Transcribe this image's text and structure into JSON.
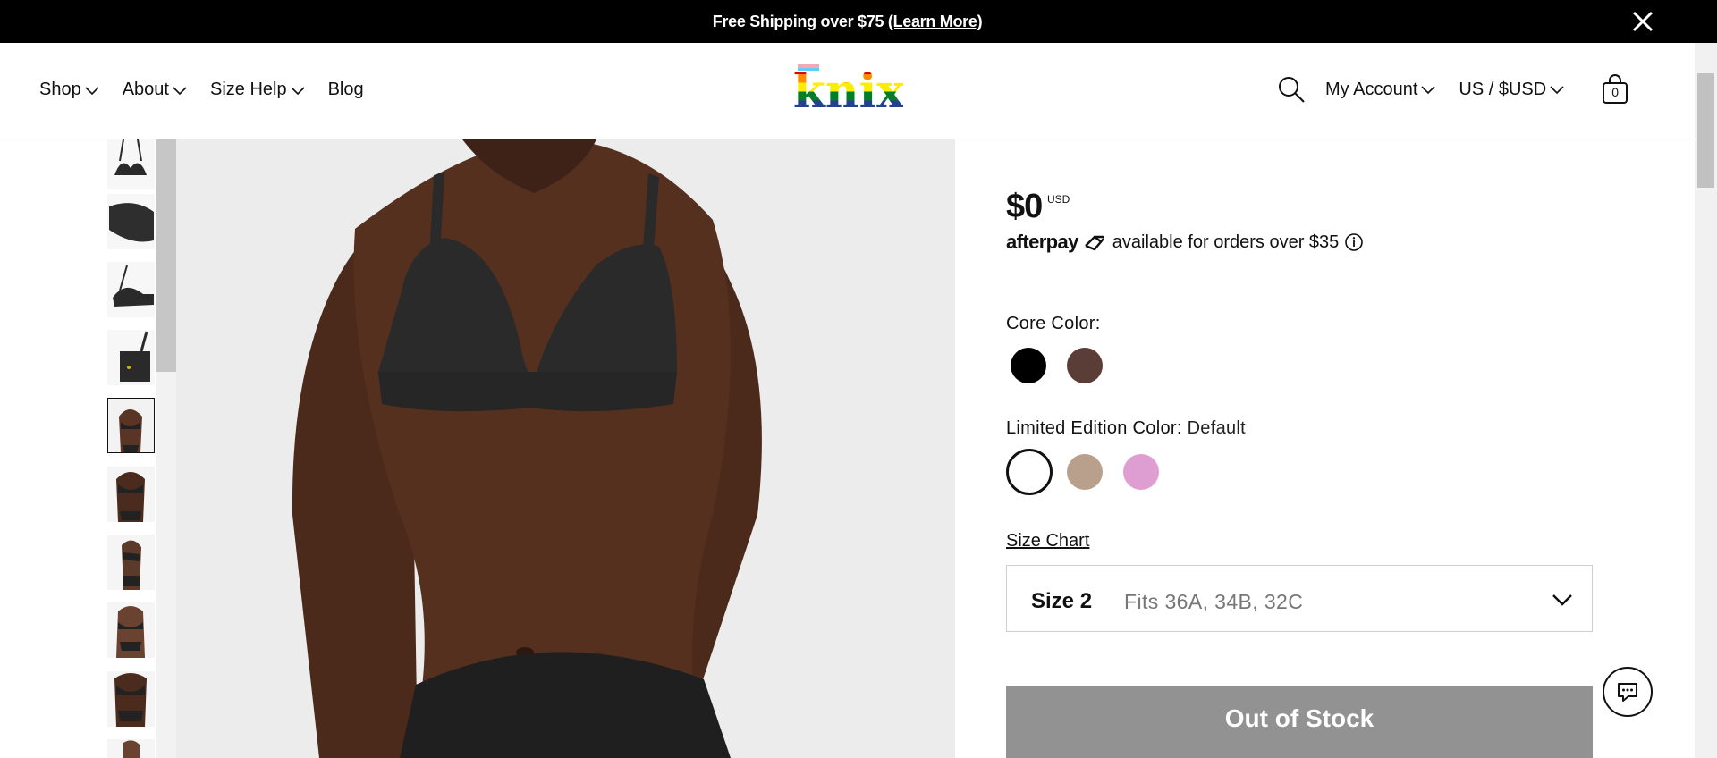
{
  "announcement": {
    "text": "Free Shipping over $75 ",
    "link": "(Learn More)"
  },
  "header": {
    "nav": [
      "Shop",
      "About",
      "Size Help",
      "Blog"
    ],
    "logo_text": "knix",
    "account_label": "My Account",
    "currency_label": "US / $USD",
    "cart_count": "0"
  },
  "gallery": {
    "thumbnail_count": 10,
    "selected_thumbnail_index": 4
  },
  "product": {
    "price": "$0",
    "price_currency": "USD",
    "afterpay": {
      "brand": "afterpay",
      "text": "available for orders over $35"
    },
    "core_color": {
      "label": "Core Color:",
      "swatches": [
        {
          "name": "black",
          "color": "#000000"
        },
        {
          "name": "brown",
          "color": "#5b3d38"
        }
      ]
    },
    "limited_color": {
      "label": "Limited Edition Color:",
      "value": "Default",
      "swatches": [
        {
          "name": "default",
          "color": "#ffffff",
          "selected": true
        },
        {
          "name": "taupe",
          "color": "#b9a08d"
        },
        {
          "name": "pink",
          "color": "#df9ed1"
        }
      ]
    },
    "size_chart_link": "Size Chart",
    "size": {
      "name": "Size 2",
      "fits": "Fits 36A, 34B, 32C"
    },
    "stock_button": "Out of Stock"
  },
  "colors": {
    "brand_black": "#000000",
    "button_gray": "#929292",
    "garment": "#2a2a2a",
    "skin": "#4e2d1f"
  }
}
